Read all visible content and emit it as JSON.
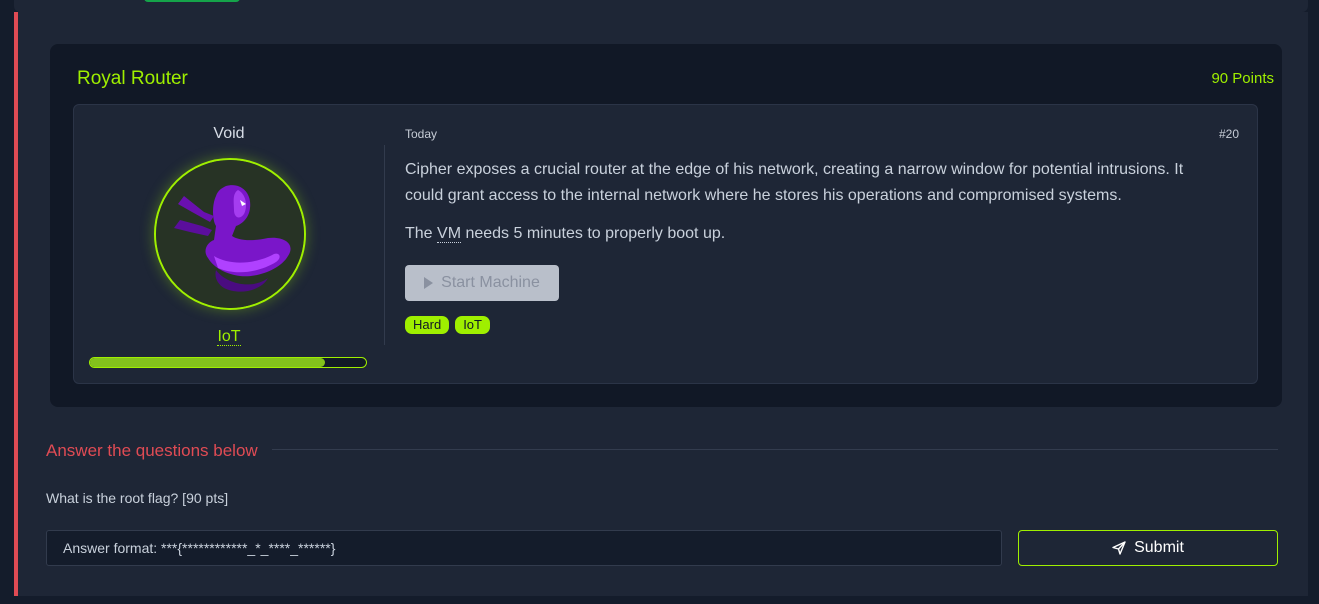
{
  "room": {
    "title": "Royal Router",
    "points": "90 Points",
    "author": "Void",
    "category": "IoT",
    "progress_fraction": 0.85,
    "date": "Today",
    "number": "#20",
    "description": "Cipher exposes a crucial router at the edge of his network, creating a narrow window for potential intrusions.  It could grant access to the internal network where he stores his operations and compromised systems.",
    "note_prefix": "The ",
    "note_abbr": "VM",
    "note_suffix": " needs 5 minutes to properly boot up.",
    "start_button": "Start Machine",
    "tags": [
      "Hard",
      "IoT"
    ]
  },
  "questions": {
    "heading": "Answer the questions below",
    "items": [
      {
        "text": "What is the root flag? [90 pts]",
        "placeholder": "Answer format: ***{************_*_****_******}",
        "submit": "Submit"
      }
    ]
  },
  "colors": {
    "accent_green": "#9fef00",
    "accent_red": "#e04b54",
    "panel": "#111826",
    "card": "#1e2636"
  }
}
